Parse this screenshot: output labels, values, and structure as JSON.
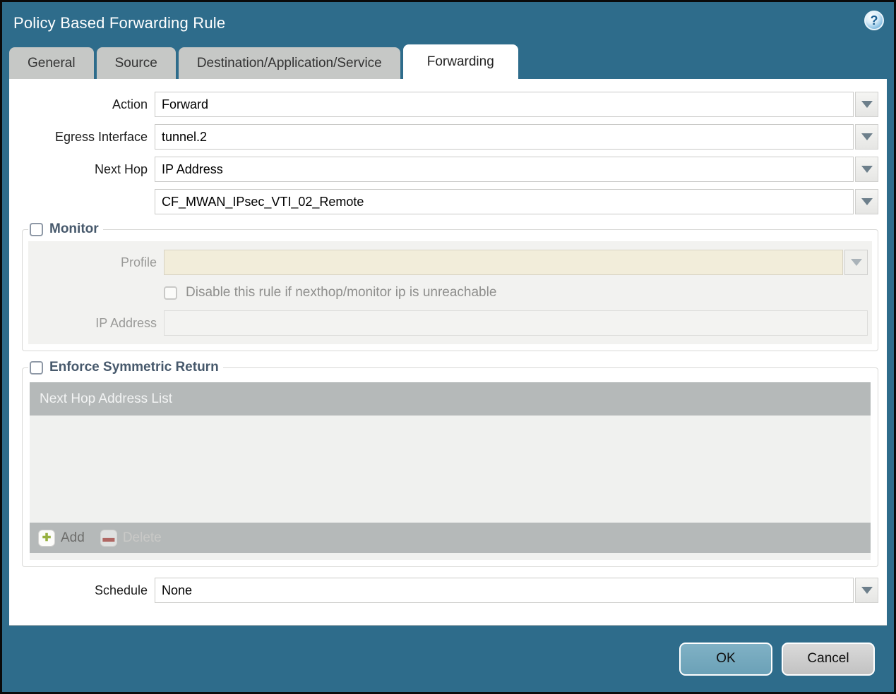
{
  "window": {
    "title": "Policy Based Forwarding Rule",
    "help_glyph": "?"
  },
  "tabs": [
    {
      "label": "General",
      "active": false
    },
    {
      "label": "Source",
      "active": false
    },
    {
      "label": "Destination/Application/Service",
      "active": false
    },
    {
      "label": "Forwarding",
      "active": true
    }
  ],
  "form": {
    "action": {
      "label": "Action",
      "value": "Forward"
    },
    "egress_interface": {
      "label": "Egress Interface",
      "value": "tunnel.2"
    },
    "next_hop": {
      "label": "Next Hop",
      "value": "IP Address"
    },
    "next_hop_target": {
      "value": "CF_MWAN_IPsec_VTI_02_Remote"
    },
    "schedule": {
      "label": "Schedule",
      "value": "None"
    }
  },
  "monitor": {
    "legend": "Monitor",
    "checked": false,
    "profile": {
      "label": "Profile",
      "value": ""
    },
    "disable_rule": {
      "label": "Disable this rule if nexthop/monitor ip is unreachable",
      "checked": false
    },
    "ip_address": {
      "label": "IP Address",
      "value": ""
    }
  },
  "symmetric_return": {
    "legend": "Enforce Symmetric Return",
    "checked": false,
    "table": {
      "header": "Next Hop Address List",
      "rows": []
    },
    "add_label": "Add",
    "delete_label": "Delete",
    "add_glyph": "✚",
    "delete_glyph": "▬"
  },
  "footer": {
    "ok_label": "OK",
    "cancel_label": "Cancel"
  },
  "colors": {
    "teal_chrome": "#2e6c8b",
    "ok_button": "#74a8bd",
    "cancel_button": "#cccccc",
    "legend_text": "#47596c",
    "table_bar": "#b5b9b9",
    "disabled_combo_bg": "#f2edda",
    "add_icon_green": "#96b03e",
    "delete_icon_red": "#b06763"
  }
}
